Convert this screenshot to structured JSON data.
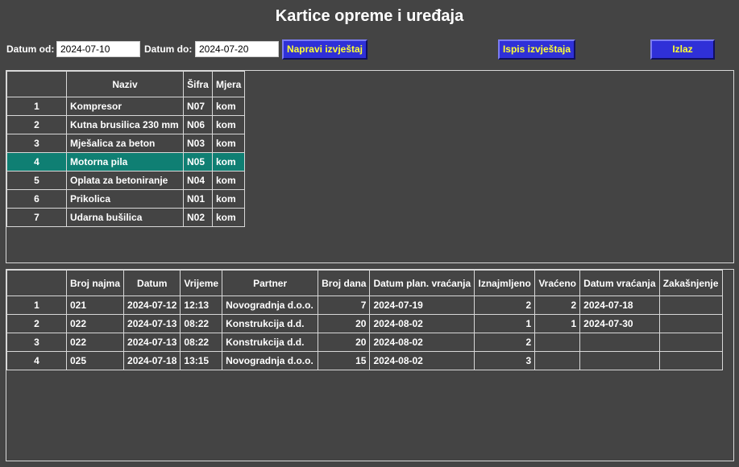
{
  "title": "Kartice opreme i uređaja",
  "filters": {
    "from_label": "Datum od:",
    "from_value": "2024-07-10",
    "to_label": "Datum do:",
    "to_value": "2024-07-20"
  },
  "buttons": {
    "make_report": "Napravi izvještaj",
    "print_report": "Ispis izvještaja",
    "exit": "Izlaz"
  },
  "equipment_table": {
    "headers": [
      "",
      "Naziv",
      "Šifra",
      "Mjera"
    ],
    "rows": [
      {
        "idx": "1",
        "naziv": "Kompresor",
        "sifra": "N07",
        "mjera": "kom"
      },
      {
        "idx": "2",
        "naziv": "Kutna brusilica 230 mm",
        "sifra": "N06",
        "mjera": "kom"
      },
      {
        "idx": "3",
        "naziv": "Mješalica za beton",
        "sifra": "N03",
        "mjera": "kom"
      },
      {
        "idx": "4",
        "naziv": "Motorna pila",
        "sifra": "N05",
        "mjera": "kom"
      },
      {
        "idx": "5",
        "naziv": "Oplata za betoniranje",
        "sifra": "N04",
        "mjera": "kom"
      },
      {
        "idx": "6",
        "naziv": "Prikolica",
        "sifra": "N01",
        "mjera": "kom"
      },
      {
        "idx": "7",
        "naziv": "Udarna bušilica",
        "sifra": "N02",
        "mjera": "kom"
      }
    ],
    "selected_row": 4
  },
  "rental_table": {
    "headers": [
      "",
      "Broj najma",
      "Datum",
      "Vrijeme",
      "Partner",
      "Broj dana",
      "Datum plan. vraćanja",
      "Iznajmljeno",
      "Vraćeno",
      "Datum vraćanja",
      "Zakašnjenje"
    ],
    "rows": [
      {
        "idx": "1",
        "broj": "021",
        "datum": "2024-07-12",
        "vrijeme": "12:13",
        "partner": "Novogradnja d.o.o.",
        "dana": "7",
        "plan": "2024-07-19",
        "izn": "2",
        "vrac": "2",
        "dvrac": "2024-07-18",
        "zak": ""
      },
      {
        "idx": "2",
        "broj": "022",
        "datum": "2024-07-13",
        "vrijeme": "08:22",
        "partner": "Konstrukcija d.d.",
        "dana": "20",
        "plan": "2024-08-02",
        "izn": "1",
        "vrac": "1",
        "dvrac": "2024-07-30",
        "zak": ""
      },
      {
        "idx": "3",
        "broj": "022",
        "datum": "2024-07-13",
        "vrijeme": "08:22",
        "partner": "Konstrukcija d.d.",
        "dana": "20",
        "plan": "2024-08-02",
        "izn": "2",
        "vrac": "",
        "dvrac": "",
        "zak": ""
      },
      {
        "idx": "4",
        "broj": "025",
        "datum": "2024-07-18",
        "vrijeme": "13:15",
        "partner": "Novogradnja d.o.o.",
        "dana": "15",
        "plan": "2024-08-02",
        "izn": "3",
        "vrac": "",
        "dvrac": "",
        "zak": ""
      }
    ]
  }
}
